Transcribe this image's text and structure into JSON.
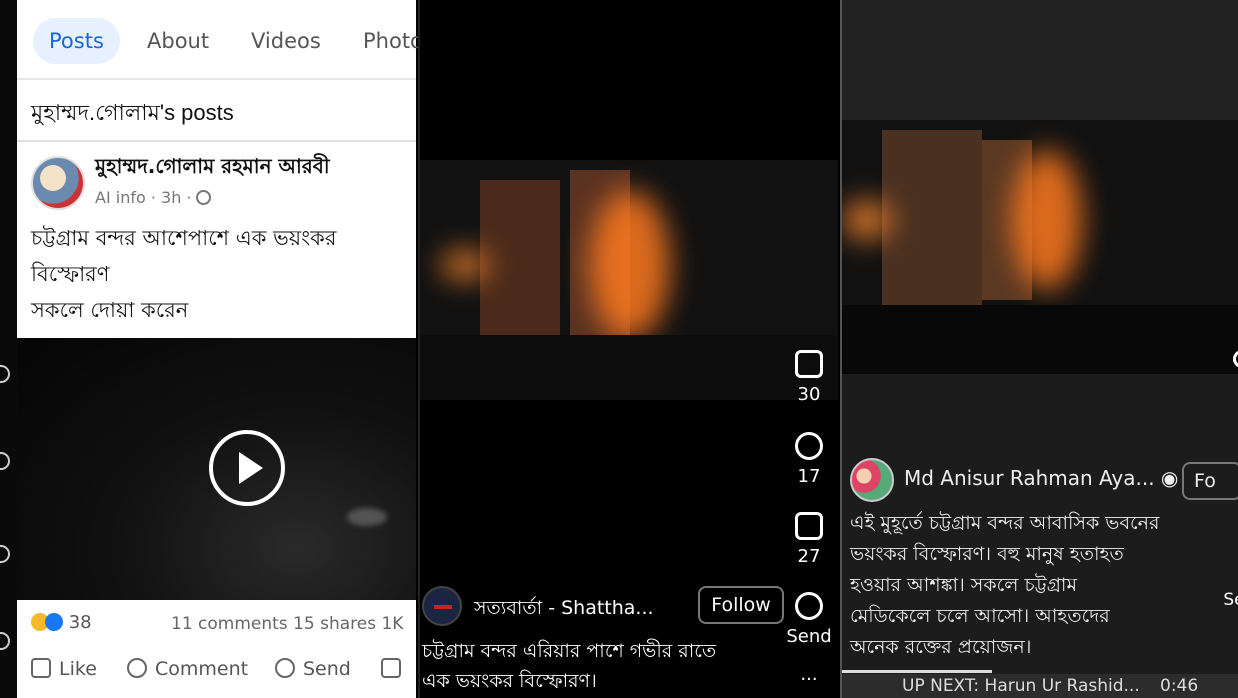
{
  "panel1": {
    "tabs": [
      {
        "label": "Posts",
        "active": true
      },
      {
        "label": "About"
      },
      {
        "label": "Videos"
      },
      {
        "label": "Photo"
      }
    ],
    "page_title": "মুহাম্মদ.গোলাম's posts",
    "author": "মুহাম্মদ.গোলাম রহমান আরবী",
    "meta": "AI info · 3h ·",
    "text_lines": [
      "চট্টগ্রাম বন্দর আশেপাশে  এক ভয়ংকর",
      "বিস্ফোরণ",
      "সকলে দোয়া করেন"
    ],
    "reaction_count": "38",
    "stats": "11 comments  15 shares  1K",
    "actions": {
      "like": "Like",
      "comment": "Comment",
      "send": "Send"
    }
  },
  "panel2": {
    "likes": "30",
    "comments": "17",
    "shares": "27",
    "send_label": "Send",
    "more": "...",
    "channel": "সত্যবার্তা - Shattha...",
    "follow": "Follow",
    "caption_lines": [
      "চট্টগ্রাম বন্দর এরিয়ার পাশে গভীর রাতে",
      "এক ভয়ংকর বিস্ফোরণ।"
    ]
  },
  "panel3": {
    "author": "Md Anisur Rahman Aya...",
    "follow": "Fo",
    "text_lines": [
      "এই মুহূর্তে চট্টগ্রাম বন্দর আবাসিক ভবনের",
      "ভয়ংকর বিস্ফোরণ। বহু মানুষ হতাহত",
      "হওয়ার আশঙ্কা। সকলে চট্টগ্রাম",
      "মেডিকেলে চলে আসো। আহতদের",
      "অনেক রক্তের প্রয়োজন।"
    ],
    "up_next": "UP NEXT: Harun Ur Rashid...",
    "duration": "0:46",
    "side_label": "Se"
  },
  "colors": {
    "accent": "#1a66d8",
    "fire": "#ff7a20"
  }
}
